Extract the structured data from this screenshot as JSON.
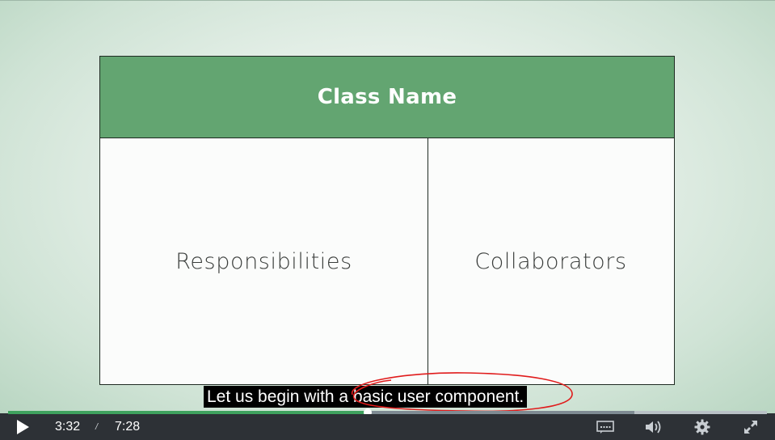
{
  "slide": {
    "class_name": "Class Name",
    "left_column": "Responsibilities",
    "right_column": "Collaborators",
    "header_color": "#63a571"
  },
  "caption": {
    "text": "Let us begin with a basic user component."
  },
  "player": {
    "current_time": "3:32",
    "separator": "/",
    "duration": "7:28",
    "played_fraction": 0.474,
    "buffered_fraction": 0.825,
    "accent_color": "#3fa25e",
    "icons": {
      "play": "play-icon",
      "captions": "captions-icon",
      "volume": "volume-icon",
      "settings": "gear-icon",
      "fullscreen": "fullscreen-icon"
    }
  }
}
